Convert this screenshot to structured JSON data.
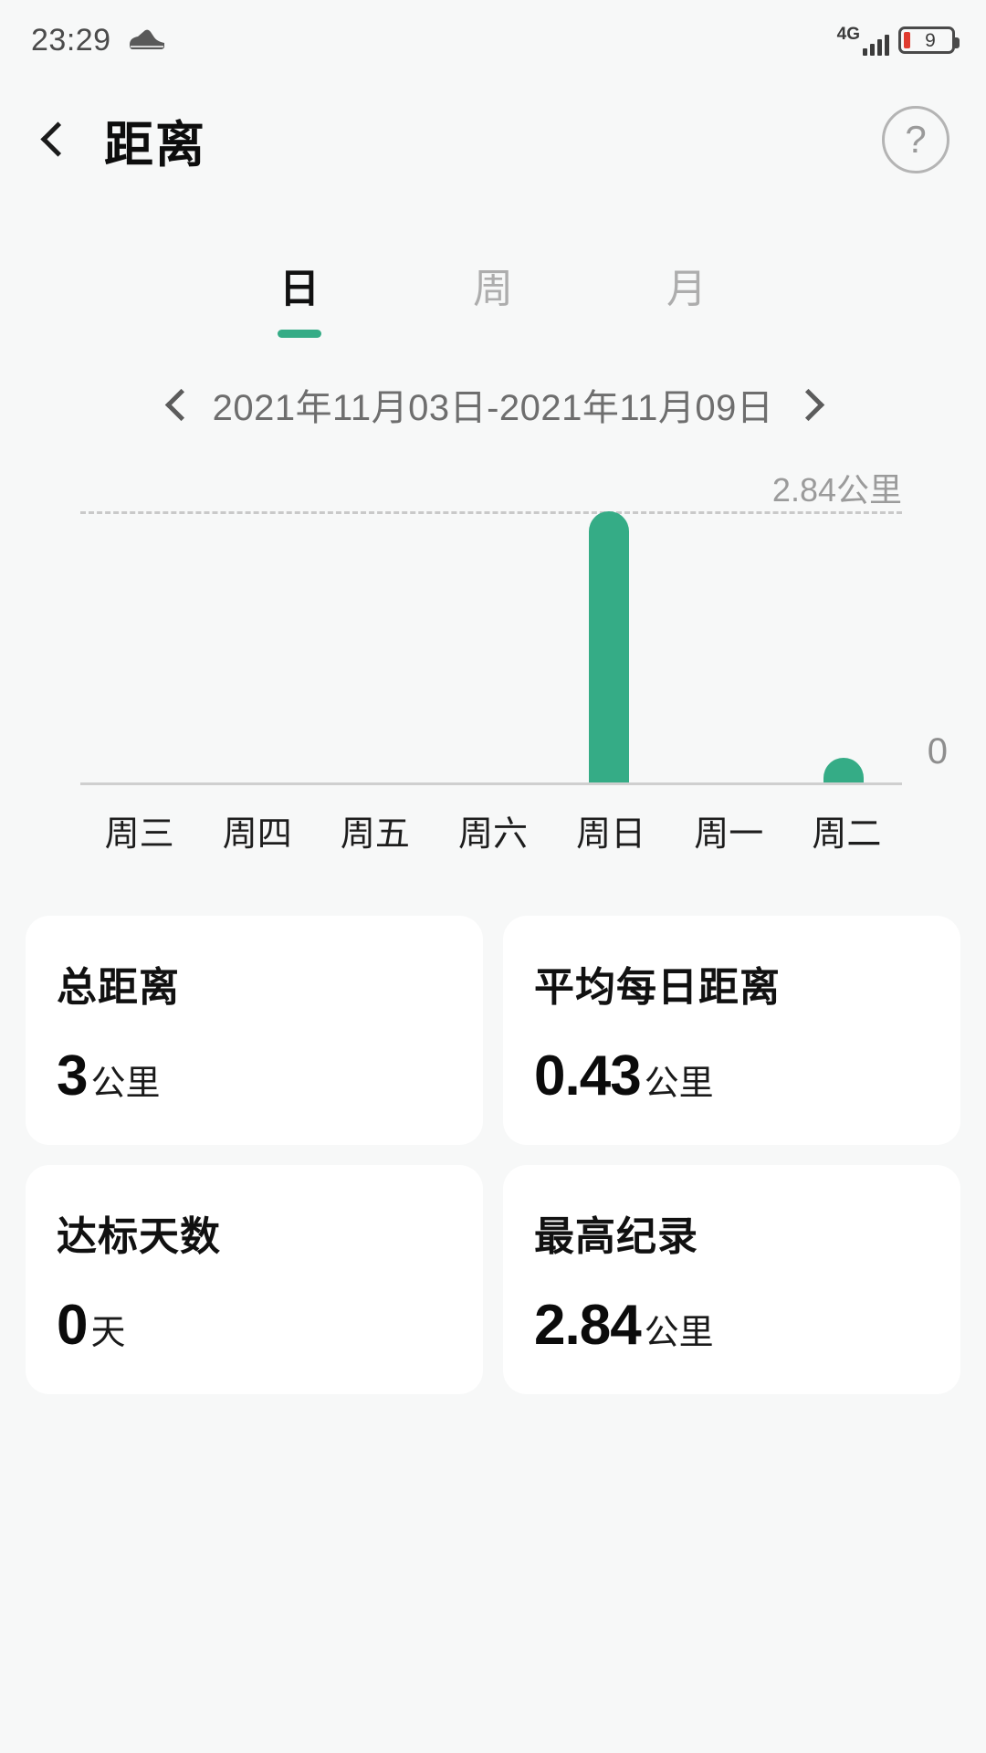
{
  "statusbar": {
    "time": "23:29",
    "shoe_icon": "shoe-icon",
    "network_type": "4G",
    "battery_level": "9"
  },
  "header": {
    "back_icon": "back-chevron-icon",
    "title": "距离",
    "help_icon": "question-mark-icon"
  },
  "tabs": [
    {
      "label": "日",
      "active": true
    },
    {
      "label": "周",
      "active": false
    },
    {
      "label": "月",
      "active": false
    }
  ],
  "date_range": {
    "prev_icon": "chevron-left-icon",
    "label": "2021年11月03日-2021年11月09日",
    "next_icon": "chevron-right-icon"
  },
  "chart_data": {
    "type": "bar",
    "title": "",
    "categories": [
      "周三",
      "周四",
      "周五",
      "周六",
      "周日",
      "周一",
      "周二"
    ],
    "values": [
      0,
      0,
      0,
      0,
      2.84,
      0,
      0.06
    ],
    "max_label": "2.84公里",
    "zero_label": "0",
    "unit": "公里",
    "ylim": [
      0,
      2.84
    ],
    "xlabel": "",
    "ylabel": "",
    "grid": true,
    "legend": "none",
    "bar_color": "#35ac86",
    "gridline_color": "#c9c9c9"
  },
  "cards": [
    {
      "title": "总距离",
      "value": "3",
      "unit": "公里"
    },
    {
      "title": "平均每日距离",
      "value": "0.43",
      "unit": "公里"
    },
    {
      "title": "达标天数",
      "value": "0",
      "unit": "天"
    },
    {
      "title": "最高纪录",
      "value": "2.84",
      "unit": "公里"
    }
  ],
  "colors": {
    "accent": "#35ac86",
    "page_bg": "#f7f8f8",
    "card_bg": "#ffffff",
    "battery_low": "#e03b2f"
  }
}
